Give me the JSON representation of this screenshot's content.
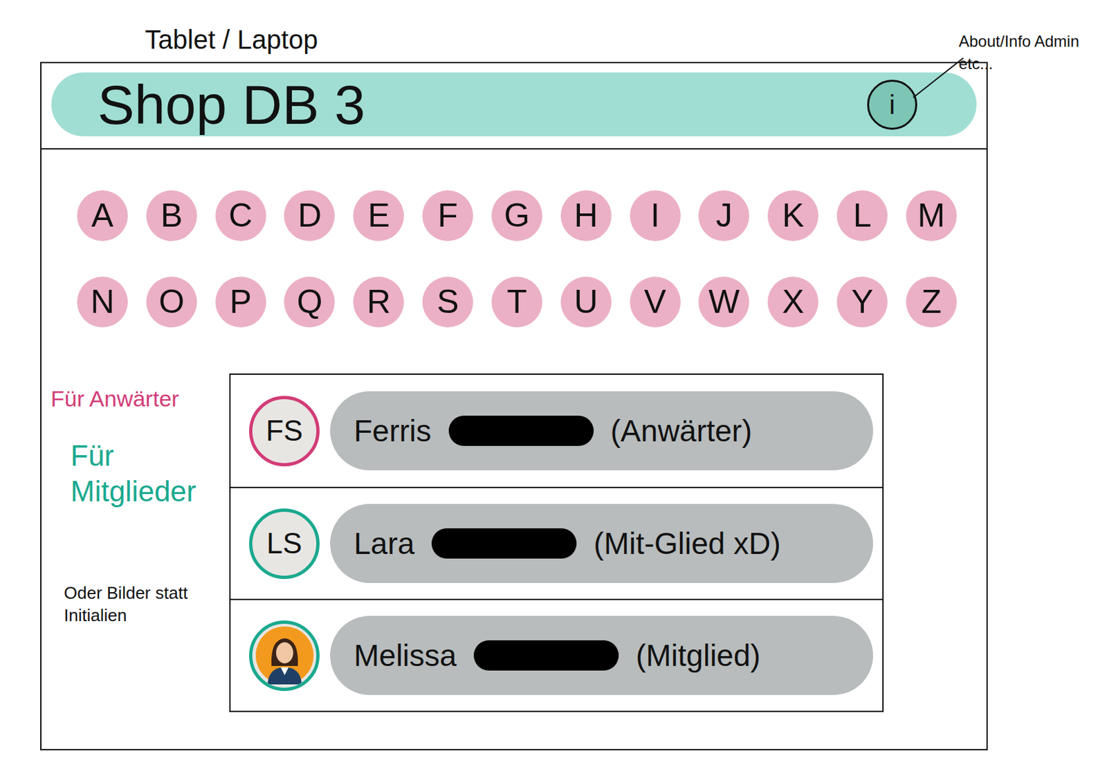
{
  "device_label": "Tablet / Laptop",
  "header": {
    "title": "Shop DB 3",
    "info_button": "i",
    "info_note": "About/Info Admin etc..."
  },
  "alphabet": [
    "A",
    "B",
    "C",
    "D",
    "E",
    "F",
    "G",
    "H",
    "I",
    "J",
    "K",
    "L",
    "M",
    "N",
    "O",
    "P",
    "Q",
    "R",
    "S",
    "T",
    "U",
    "V",
    "W",
    "X",
    "Y",
    "Z"
  ],
  "annotations": [
    {
      "text": "Für Anwärter",
      "color": "#d23c77"
    },
    {
      "text": "Für Mitglieder",
      "color": "#1aa98f"
    },
    {
      "text": "Oder Bilder statt Initialien",
      "color": "#111111"
    }
  ],
  "members": [
    {
      "kind": "initials",
      "initials": "FS",
      "first_name": "Ferris",
      "redacted": true,
      "role": "(Anwärter)",
      "color": "#d23c77"
    },
    {
      "kind": "initials",
      "initials": "LS",
      "first_name": "Lara",
      "redacted": true,
      "role": "(Mit-Glied xD)",
      "color": "#1aa98f"
    },
    {
      "kind": "picture",
      "initials": "",
      "first_name": "Melissa",
      "redacted": true,
      "role": "(Mitglied)",
      "color": "#1aa98f"
    }
  ]
}
